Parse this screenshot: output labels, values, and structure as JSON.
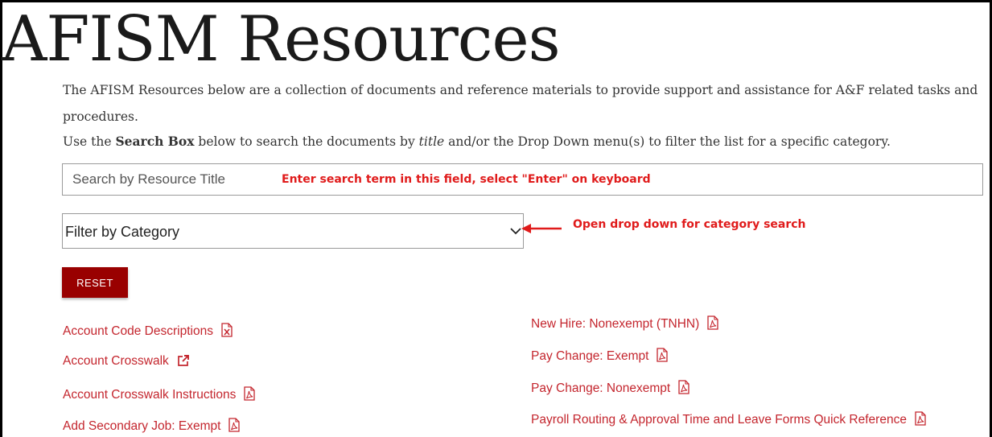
{
  "page": {
    "title": "AFISM Resources",
    "intro": {
      "line1": "The AFISM Resources below are a collection of documents and reference materials to provide support and assistance for A&F related tasks and procedures.",
      "line2_prefix": "Use the ",
      "line2_bold": "Search Box",
      "line2_mid": " below to search the documents by ",
      "line2_italic": "title",
      "line2_suffix": " and/or the Drop Down menu(s) to filter the list for a specific category."
    }
  },
  "search": {
    "placeholder": "Search by Resource Title",
    "value": ""
  },
  "annotations": {
    "search_hint": "Enter search term in this field, select \"Enter\" on keyboard",
    "filter_hint": "Open drop down for category search",
    "color": "#e01b1b"
  },
  "filter": {
    "selected": "Filter by Category"
  },
  "reset": {
    "label": "RESET",
    "color": "#990000"
  },
  "resources": {
    "link_color": "#c4262e",
    "left": [
      {
        "label": "Account Code Descriptions",
        "icon": "excel-file-icon"
      },
      {
        "label": "Account Crosswalk",
        "icon": "external-link-icon"
      },
      {
        "label": "Account Crosswalk Instructions",
        "icon": "pdf-file-icon"
      },
      {
        "label": "Add Secondary Job: Exempt",
        "icon": "pdf-file-icon"
      }
    ],
    "right": [
      {
        "label": "New Hire: Nonexempt (TNHN)",
        "icon": "pdf-file-icon"
      },
      {
        "label": "Pay Change: Exempt",
        "icon": "pdf-file-icon"
      },
      {
        "label": "Pay Change: Nonexempt",
        "icon": "pdf-file-icon"
      },
      {
        "label": "Payroll Routing & Approval Time and Leave Forms Quick Reference",
        "icon": "pdf-file-icon"
      }
    ]
  }
}
